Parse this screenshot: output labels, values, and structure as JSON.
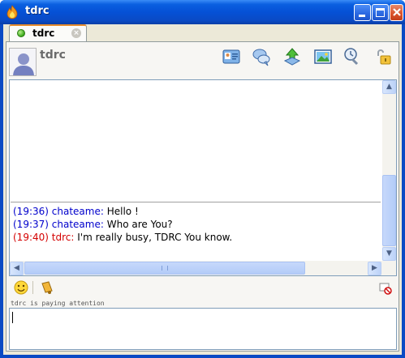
{
  "window": {
    "title": "tdrc",
    "controls": [
      "minimize",
      "maximize",
      "close"
    ]
  },
  "tab": {
    "label": "tdrc",
    "status_color": "#3aa81a"
  },
  "contact": {
    "name": "tdrc"
  },
  "toolbar": {
    "icons": [
      "contact-card-icon",
      "chat-bubbles-icon",
      "send-file-icon",
      "picture-icon",
      "history-icon",
      "lock-icon"
    ]
  },
  "chat": {
    "messages": [
      {
        "time": "(19:36)",
        "sender": "chateame",
        "text": "Hello !",
        "color": "#0000cc"
      },
      {
        "time": "(19:37)",
        "sender": "chateame",
        "text": "Who are You?",
        "color": "#0000cc"
      },
      {
        "time": "(19:40)",
        "sender": "tdrc",
        "text": "I'm really busy, TDRC You know.",
        "color": "#d40000"
      }
    ]
  },
  "compose": {
    "status": "tdrc is paying attention",
    "value": ""
  },
  "colors": {
    "titlebar": "#0551d6",
    "frame": "#ece9d8",
    "tab_accent": "#e68b2c"
  }
}
